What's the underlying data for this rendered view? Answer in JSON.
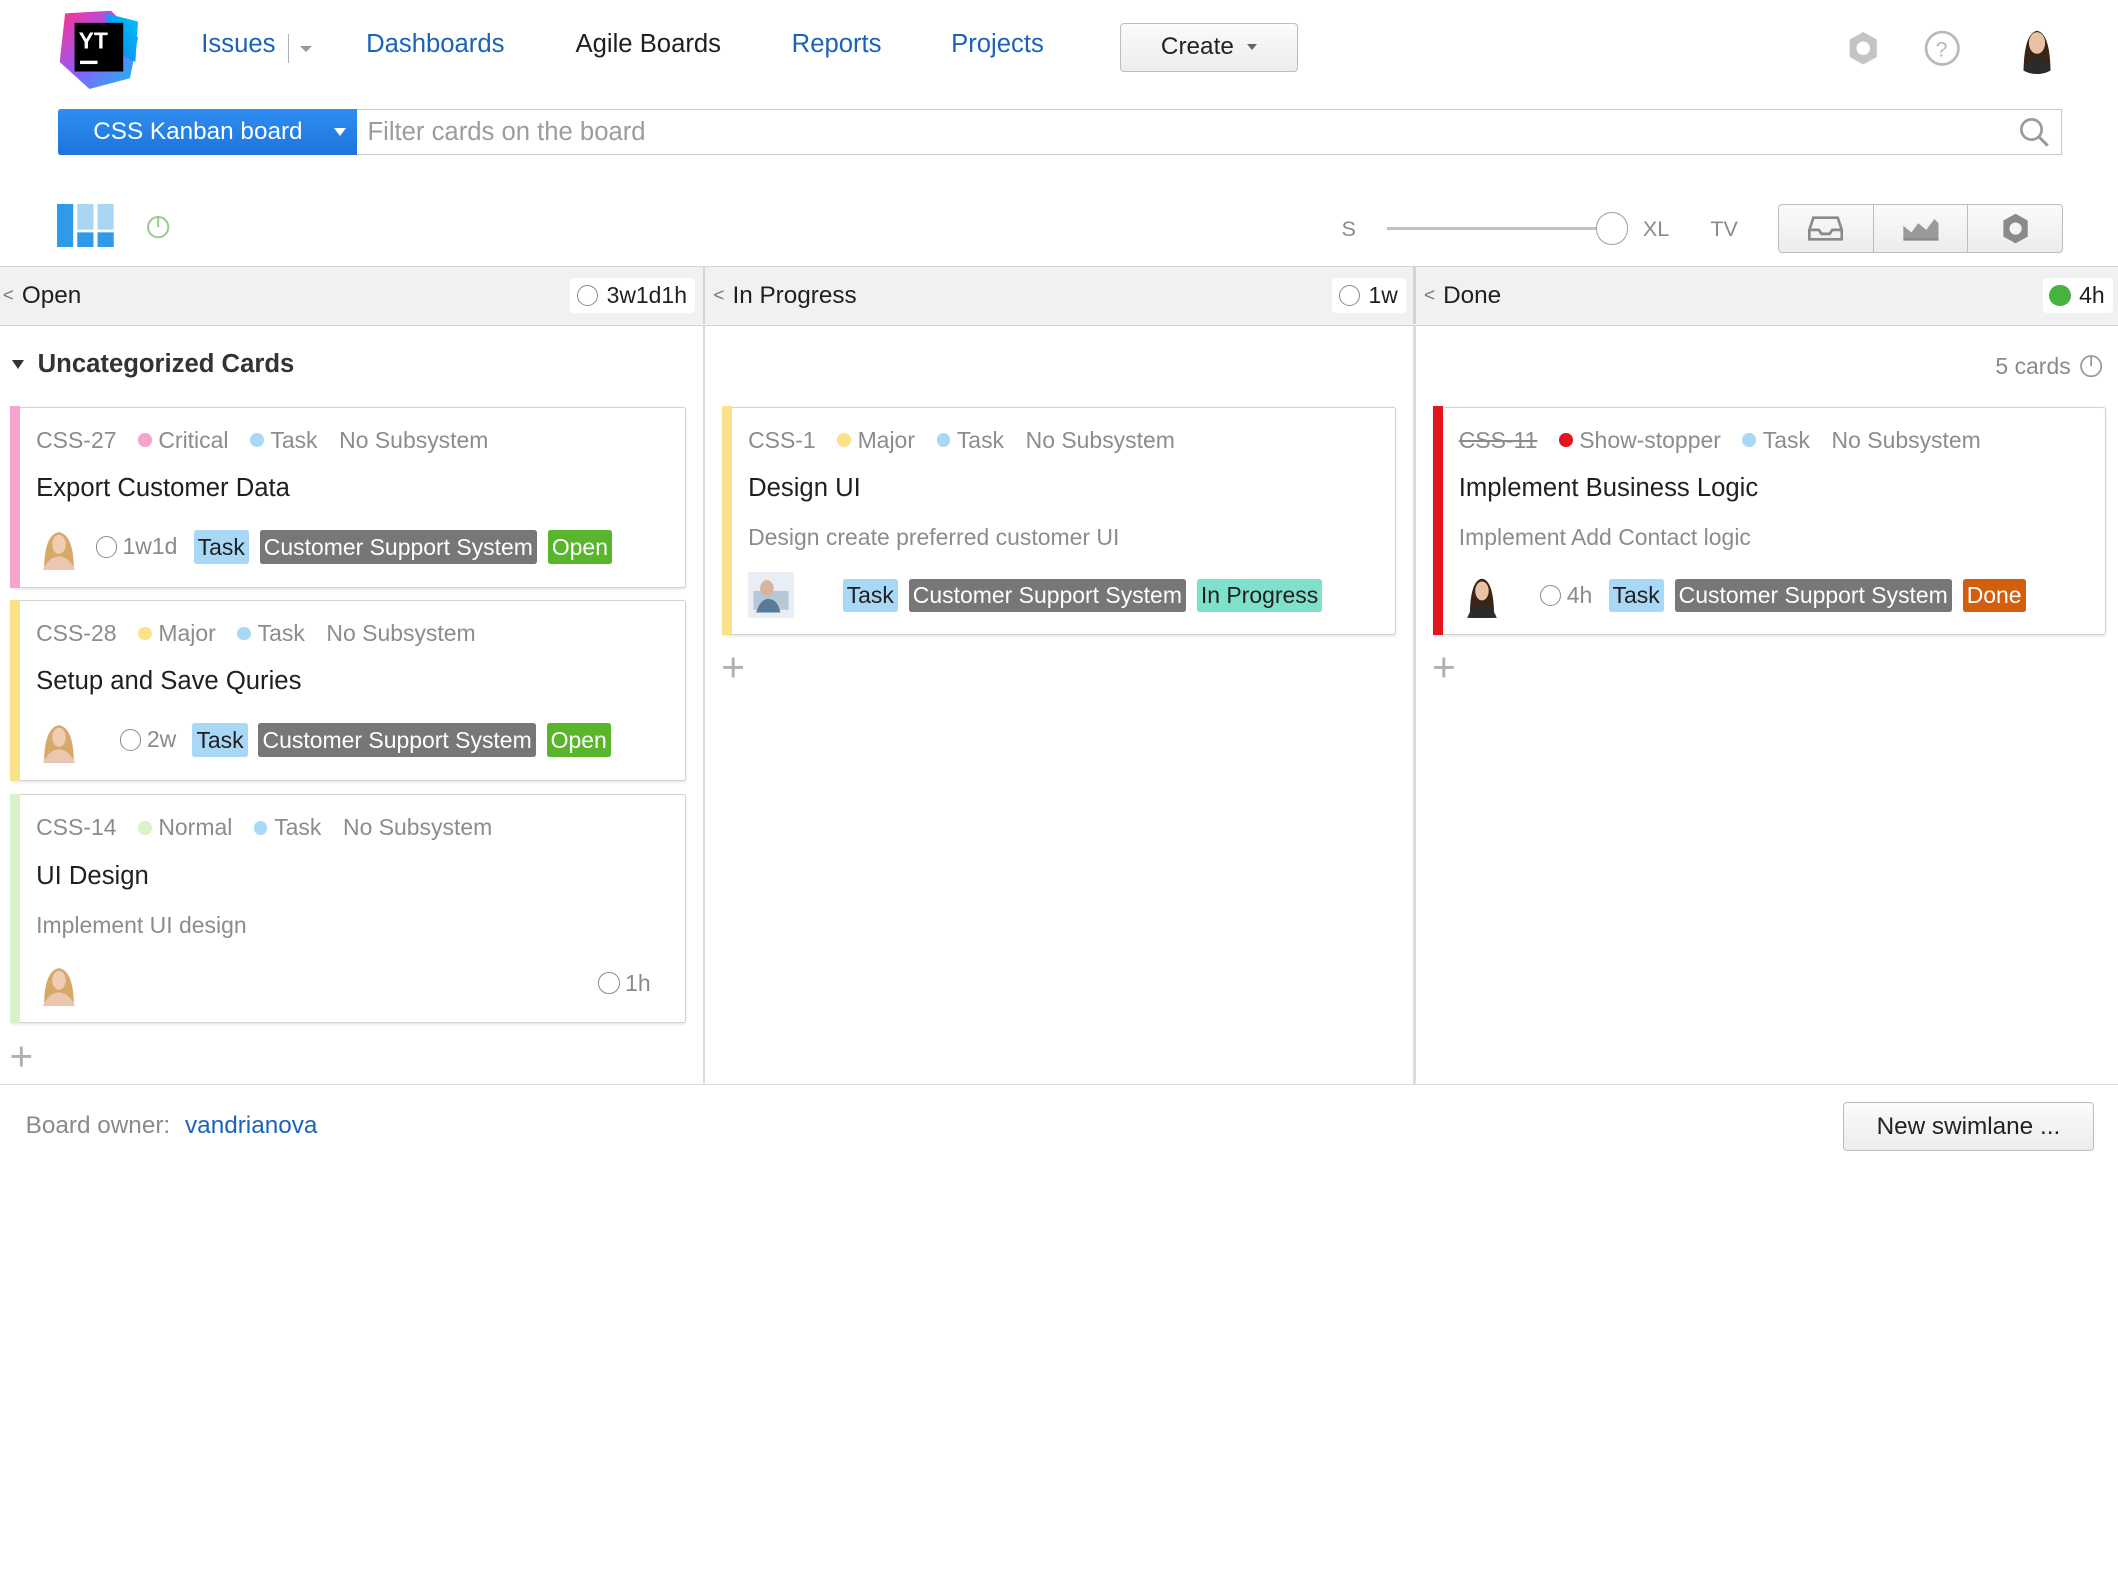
{
  "header": {
    "logo_text": "YT",
    "nav": [
      "Issues",
      "Dashboards",
      "Agile Boards",
      "Reports",
      "Projects"
    ],
    "active_nav": "Agile Boards",
    "create_label": "Create"
  },
  "board": {
    "name": "CSS Kanban board",
    "filter_placeholder": "Filter cards on the board"
  },
  "toolbar": {
    "size_small": "S",
    "size_large": "XL",
    "size_tv": "TV",
    "card_size_level": 1.0
  },
  "columns": [
    {
      "name": "Open",
      "estimate": "3w1d1h",
      "estimate_status": "empty"
    },
    {
      "name": "In Progress",
      "estimate": "1w",
      "estimate_status": "empty"
    },
    {
      "name": "Done",
      "estimate": "4h",
      "estimate_status": "complete"
    }
  ],
  "swimlane": {
    "title": "Uncategorized Cards",
    "count": "5 cards"
  },
  "cards": [
    {
      "id": "CSS-27",
      "priority": "Critical",
      "type": "Task",
      "subsystem": "No Subsystem",
      "title": "Export Customer Data",
      "description": "",
      "estimate": "1w1d",
      "tags": [
        "Task",
        "Customer Support System",
        "Open"
      ],
      "priority_color": "#f6a3cf",
      "column": "Open"
    },
    {
      "id": "CSS-28",
      "priority": "Major",
      "type": "Task",
      "subsystem": "No Subsystem",
      "title": "Setup and Save Quries",
      "description": "",
      "estimate": "2w",
      "tags": [
        "Task",
        "Customer Support System",
        "Open"
      ],
      "priority_color": "#fbe289",
      "column": "Open"
    },
    {
      "id": "CSS-14",
      "priority": "Normal",
      "type": "Task",
      "subsystem": "No Subsystem",
      "title": "UI Design",
      "description": "Implement UI design",
      "estimate": "1h",
      "tags": [],
      "priority_color": "#daf2c8",
      "column": "Open"
    },
    {
      "id": "CSS-1",
      "priority": "Major",
      "type": "Task",
      "subsystem": "No Subsystem",
      "title": "Design UI",
      "description": "Design create preferred customer UI",
      "estimate": "",
      "tags": [
        "Task",
        "Customer Support System",
        "In Progress"
      ],
      "priority_color": "#fbe289",
      "column": "In Progress"
    },
    {
      "id": "CSS-11",
      "priority": "Show-stopper",
      "type": "Task",
      "subsystem": "No Subsystem",
      "title": "Implement Business Logic",
      "description": "Implement Add Contact logic",
      "estimate": "4h",
      "tags": [
        "Task",
        "Customer Support System",
        "Done"
      ],
      "priority_color": "#e3161f",
      "column": "Done"
    }
  ],
  "footer": {
    "owner_label": "Board owner:",
    "owner_name": "vandrianova",
    "new_swimlane_label": "New swimlane ..."
  },
  "colors": {
    "accent": "#1d74dc",
    "link": "#1a63b8",
    "task_tag": "#a8d8f5",
    "system_tag": "#777777",
    "open_tag": "#59b52c",
    "in_progress_tag": "#7fe0cc",
    "done_tag": "#d35e0d"
  }
}
